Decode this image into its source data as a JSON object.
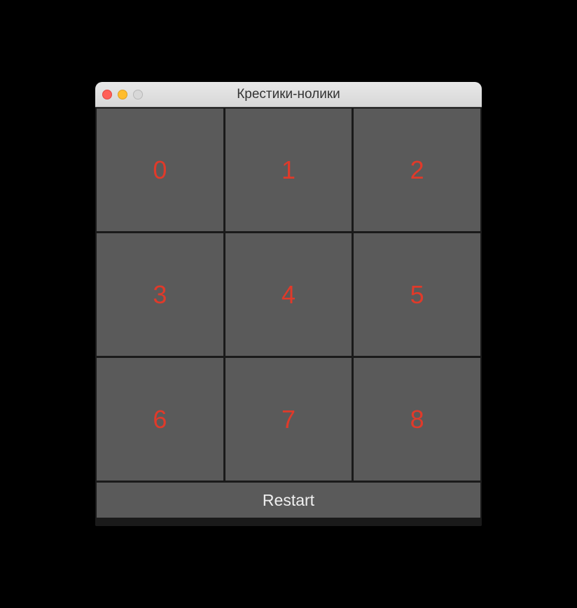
{
  "window": {
    "title": "Крестики-нолики"
  },
  "grid": {
    "cells": [
      "0",
      "1",
      "2",
      "3",
      "4",
      "5",
      "6",
      "7",
      "8"
    ]
  },
  "controls": {
    "restart_label": "Restart"
  },
  "colors": {
    "cell_text": "#e03a2a",
    "cell_bg": "#5a5a5a",
    "window_bg": "#1a1a1a"
  }
}
